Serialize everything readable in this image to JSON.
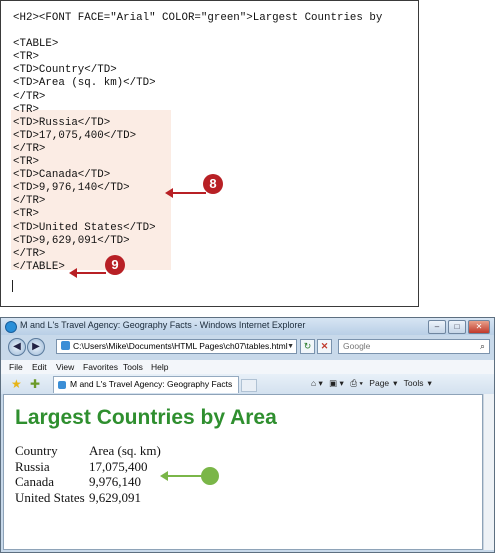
{
  "code": {
    "lines": [
      "<H2><FONT FACE=\"Arial\" COLOR=\"green\">Largest Countries by",
      "",
      "<TABLE>",
      "<TR>",
      "<TD>Country</TD>",
      "<TD>Area (sq. km)</TD>",
      "</TR>",
      "<TR>",
      "<TD>Russia</TD>",
      "<TD>17,075,400</TD>",
      "</TR>",
      "<TR>",
      "<TD>Canada</TD>",
      "<TD>9,976,140</TD>",
      "</TR>",
      "<TR>",
      "<TD>United States</TD>",
      "<TD>9,629,091</TD>",
      "</TR>",
      "</TABLE>"
    ],
    "callout_8": "8",
    "callout_9": "9"
  },
  "browser": {
    "title": "M and L's Travel Agency: Geography Facts - Windows Internet Explorer",
    "address": "C:\\Users\\Mike\\Documents\\HTML Pages\\ch07\\tables.html",
    "search_placeholder": "Google",
    "menu": [
      "File",
      "Edit",
      "View",
      "Favorites",
      "Tools",
      "Help"
    ],
    "tab_label": "M and L's Travel Agency: Geography Facts",
    "cmd": [
      "Page",
      "Tools"
    ],
    "page": {
      "heading": "Largest Countries by Area",
      "table": {
        "headers": [
          "Country",
          "Area (sq. km)"
        ],
        "rows": [
          [
            "Russia",
            "17,075,400"
          ],
          [
            "Canada",
            "9,976,140"
          ],
          [
            "United States",
            "9,629,091"
          ]
        ]
      }
    }
  },
  "colors": {
    "callout_red": "#b82025",
    "callout_green": "#7ab648",
    "heading_green": "#2f8f2f",
    "highlight": "#fbece4"
  }
}
